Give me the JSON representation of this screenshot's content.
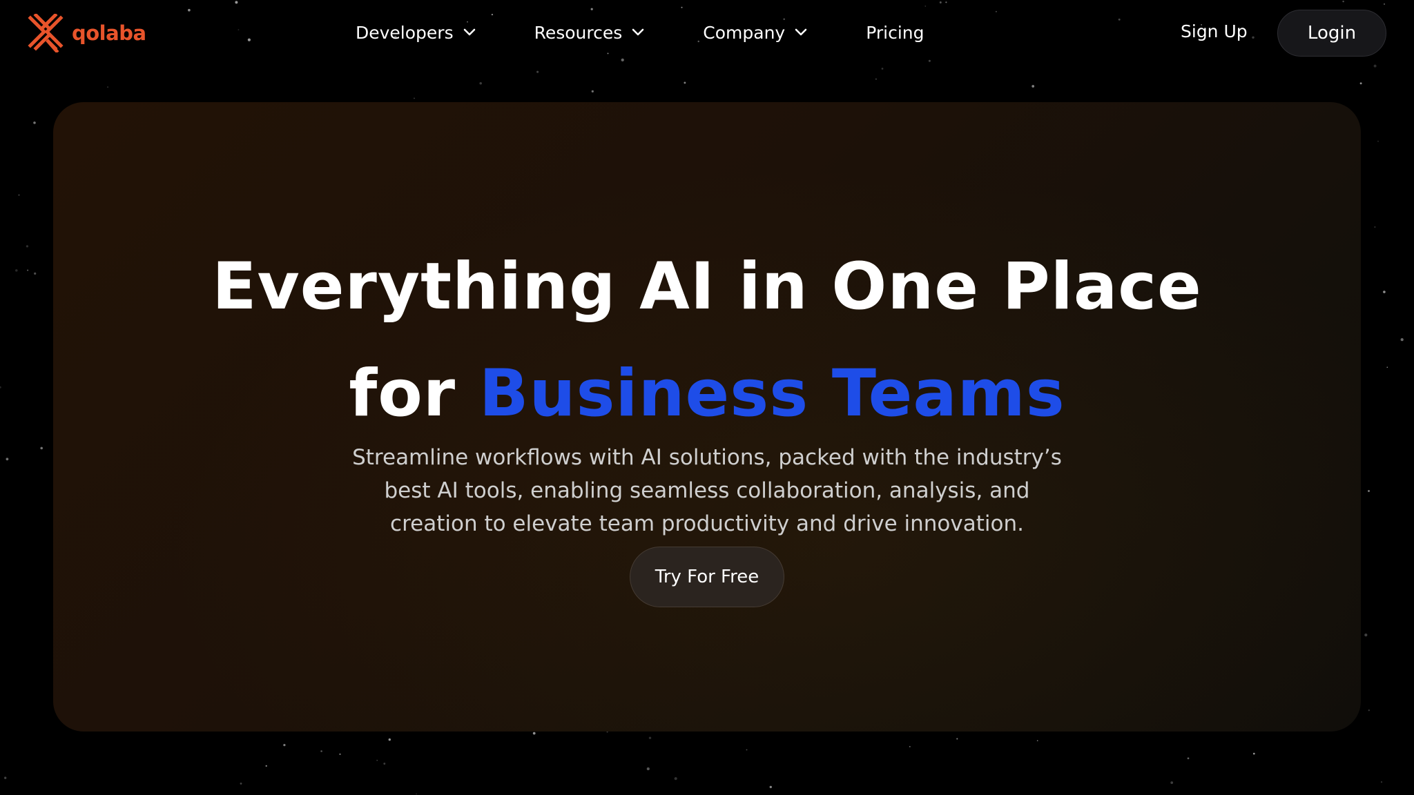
{
  "brand": {
    "name": "qolaba",
    "color": "#e8542b"
  },
  "nav": {
    "items": [
      {
        "label": "Developers",
        "has_dropdown": true
      },
      {
        "label": "Resources",
        "has_dropdown": true
      },
      {
        "label": "Company",
        "has_dropdown": true
      },
      {
        "label": "Pricing",
        "has_dropdown": false
      }
    ],
    "signup_label": "Sign Up",
    "login_label": "Login"
  },
  "hero": {
    "headline_line1": "Everything AI in One Place",
    "headline_line2_prefix": "for ",
    "headline_line2_accent": "Business Teams",
    "accent_color": "#1e4de8",
    "subtitle_lines": [
      "Streamline workflows with AI solutions, packed with the industry’s",
      "best AI tools, enabling seamless collaboration, analysis, and",
      "creation to elevate team productivity and drive innovation."
    ],
    "cta_label": "Try For Free"
  },
  "icons": {
    "logo": "qolaba-logo-icon",
    "dropdown": "chevron-down-icon"
  }
}
